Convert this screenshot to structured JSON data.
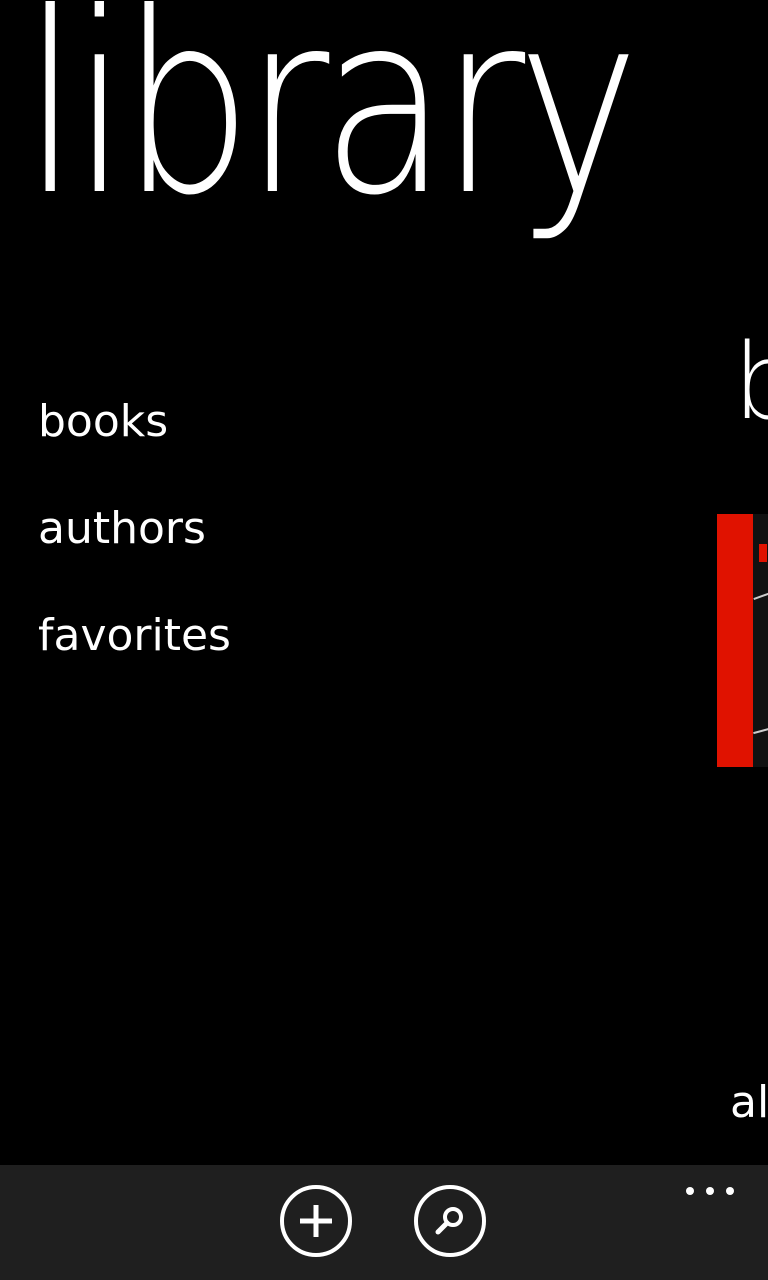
{
  "panorama": {
    "title": "library"
  },
  "menu": {
    "items": [
      {
        "label": "books"
      },
      {
        "label": "authors"
      },
      {
        "label": "favorites"
      }
    ]
  },
  "next_section": {
    "heading_peek": "b",
    "bottom_peek": "al"
  },
  "app_bar": {
    "buttons": [
      {
        "icon": "add-icon"
      },
      {
        "icon": "search-icon"
      }
    ],
    "more_icon": "ellipsis-icon"
  },
  "colors": {
    "background": "#000000",
    "foreground": "#ffffff",
    "app_bar_background": "#1f1f1f",
    "accent_red": "#e01200"
  }
}
